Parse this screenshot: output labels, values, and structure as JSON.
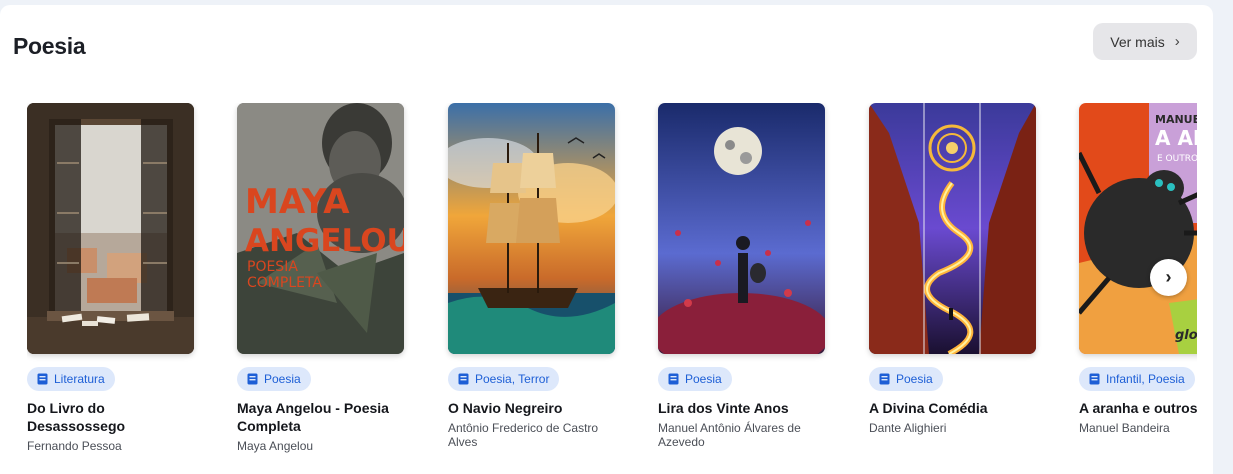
{
  "section": {
    "title": "Poesia",
    "more_label": "Ver mais",
    "more_icon": "chevron-right-icon",
    "next_icon": "chevron-right-icon"
  },
  "books": [
    {
      "category": "Literatura",
      "title": "Do Livro do Desassossego",
      "author": "Fernando Pessoa"
    },
    {
      "category": "Poesia",
      "title": "Maya Angelou - Poesia Completa",
      "author": "Maya Angelou",
      "cover_text": [
        "MAYA",
        "ANGELOU",
        "POESIA",
        "COMPLETA"
      ]
    },
    {
      "category": "Poesia, Terror",
      "title": "O Navio Negreiro",
      "author": "Antônio Frederico de Castro Alves"
    },
    {
      "category": "Poesia",
      "title": "Lira dos Vinte Anos",
      "author": "Manuel Antônio Álvares de Azevedo"
    },
    {
      "category": "Poesia",
      "title": "A Divina Comédia",
      "author": "Dante Alighieri"
    },
    {
      "category": "Infantil, Poesia",
      "title": "A aranha e outros",
      "author": "Manuel Bandeira",
      "cover_text": [
        "MANUEL",
        "A AR",
        "E OUTRO",
        "glob"
      ]
    }
  ],
  "colors": {
    "badge_bg": "#dde8fb",
    "badge_text": "#1e5fd6",
    "page_bg": "#eef2f8"
  }
}
